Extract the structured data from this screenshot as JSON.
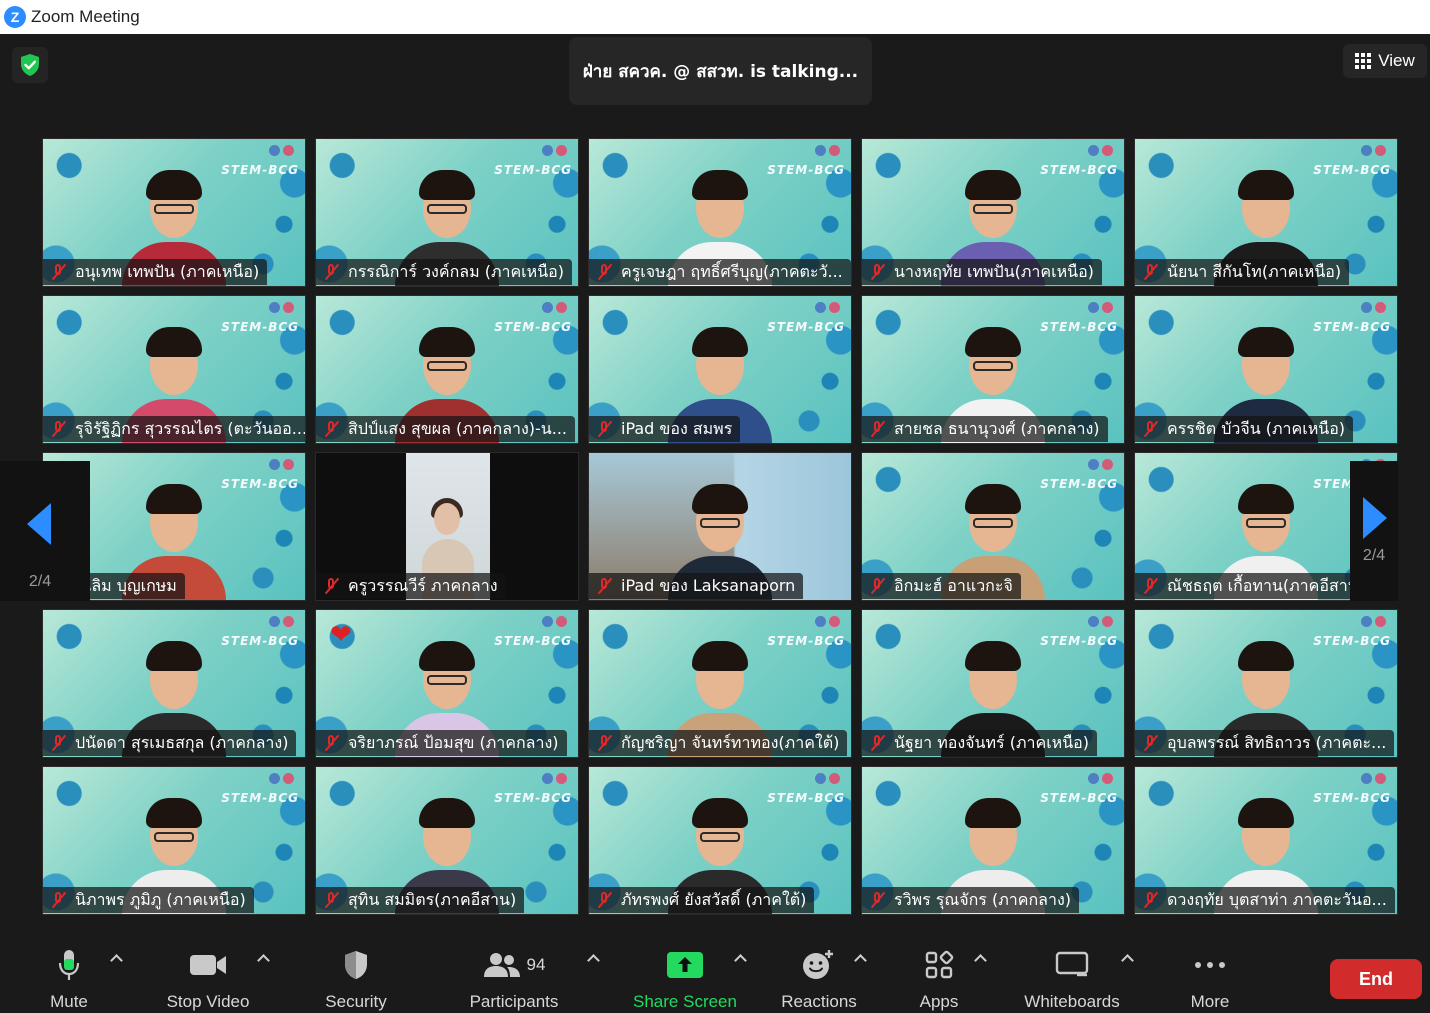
{
  "window": {
    "title": "Zoom Meeting"
  },
  "header": {
    "talking": "ฝ่าย สควค. @ สสวท. is talking...",
    "view_label": "View"
  },
  "brand_text": "STEM-BCG",
  "pagination": {
    "left": "2/4",
    "right": "2/4"
  },
  "participants": [
    {
      "name": "อนุเทพ เทพปัน (ภาคเหนือ)",
      "shirt": "#b72a3a"
    },
    {
      "name": "กรรณิการ์ วงค์กลม (ภาคเหนือ)",
      "shirt": "#2e2e2e"
    },
    {
      "name": "ครูเจษฎา ฤทธิ์ศรีบุญ(ภาคตะวั...",
      "shirt": "#f3f3f3"
    },
    {
      "name": "นางหฤทัย เทพปัน(ภาคเหนือ)",
      "shirt": "#6a5fb0"
    },
    {
      "name": "นัยนา สีกันโท(ภาคเหนือ)",
      "shirt": "#1c1c1c"
    },
    {
      "name": "รุจิรัฐิฏิกร สุวรรณไตร (ตะวันออ...",
      "shirt": "#d44a6a"
    },
    {
      "name": "สิปป์แสง สุขผล (ภาคกลาง)-น...",
      "shirt": "#a03030"
    },
    {
      "name": "iPad ของ สมพร",
      "shirt": "#2f4f8a"
    },
    {
      "name": "สายชล ธนานุวงศ์ (ภาคกลาง)",
      "shirt": "#f2f2f2"
    },
    {
      "name": "ครรชิต บัวจีน (ภาคเหนือ)",
      "shirt": "#1e2a40"
    },
    {
      "name": "เฉลิม บุญเกษม",
      "shirt": "#c44a3a"
    },
    {
      "name": "ครูวรรณวีร์ ภาคกลาง",
      "shirt": "#d8c7b5"
    },
    {
      "name": "iPad ของ Laksanaporn",
      "shirt": "#1e2a38"
    },
    {
      "name": "อิกมะฮ์ อาแวกะจิ",
      "shirt": "#c8a078"
    },
    {
      "name": "ณัชธฤต เกื้อทาน(ภาคอีสาน)",
      "shirt": "#f0f0f0"
    },
    {
      "name": "ปนัดดา สุรเมธสกุล (ภาคกลาง)",
      "shirt": "#2a2a2a"
    },
    {
      "name": "จริยาภรณ์ ป้อมสุข (ภาคกลาง)",
      "shirt": "#d9c6e6"
    },
    {
      "name": "กัญชริญา จันทร์ทาทอง(ภาคใต้)",
      "shirt": "#caa27a"
    },
    {
      "name": "นัฐยา ทองจันทร์ (ภาคเหนือ)",
      "shirt": "#1a1a1a"
    },
    {
      "name": "อุบลพรรณ์ สิทธิถาวร (ภาคตะ...",
      "shirt": "#2a2a2a"
    },
    {
      "name": "นิภาพร ภูมิภู (ภาคเหนือ)",
      "shirt": "#ededed"
    },
    {
      "name": "สุทิน สมมิตร(ภาคอีสาน)",
      "shirt": "#3a3a4a"
    },
    {
      "name": "ภัทรพงศ์ ยังสวัสดิ์ (ภาคใต้)",
      "shirt": "#2a2a2a"
    },
    {
      "name": "รวิพร รุณจักร (ภาคกลาง)",
      "shirt": "#ededed"
    },
    {
      "name": "ดวงฤทัย บุตสาท่า ภาคตะวันอ...",
      "shirt": "#f0f0f0"
    }
  ],
  "toolbar": {
    "mute": "Mute",
    "stop_video": "Stop Video",
    "security": "Security",
    "participants": "Participants",
    "participants_count": "94",
    "share_screen": "Share Screen",
    "reactions": "Reactions",
    "apps": "Apps",
    "whiteboards": "Whiteboards",
    "more": "More",
    "end": "End"
  },
  "colors": {
    "accent": "#2d8cff",
    "share": "#23d95f",
    "end": "#d12b2b",
    "muted": "#e02828"
  }
}
